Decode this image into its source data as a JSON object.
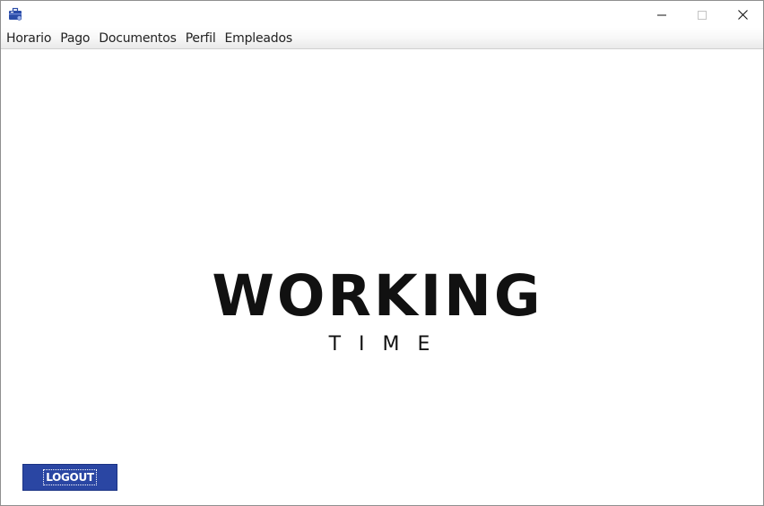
{
  "menu": {
    "items": [
      "Horario",
      "Pago",
      "Documentos",
      "Perfil",
      "Empleados"
    ]
  },
  "logo": {
    "main": "WORKING",
    "sub": "TIME"
  },
  "logout": {
    "label": "LOGOUT"
  },
  "icons": {
    "app": "briefcase-icon",
    "minimize": "minimize-icon",
    "maximize": "maximize-icon",
    "close": "close-icon"
  },
  "colors": {
    "logout_bg": "#2a46a3",
    "logo_text": "#111111"
  }
}
